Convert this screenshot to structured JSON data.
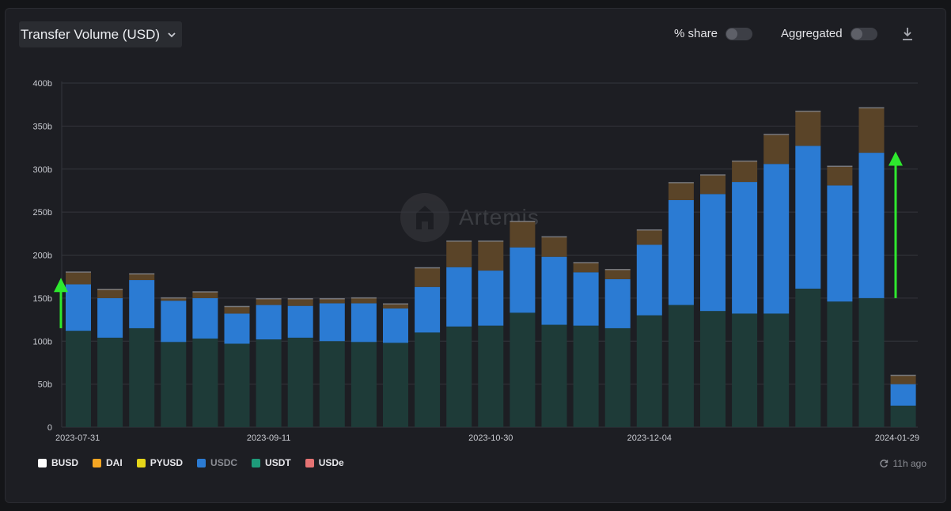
{
  "header": {
    "metric_label": "Transfer Volume (USD)",
    "share_label": "% share",
    "aggregated_label": "Aggregated",
    "share_on": false,
    "aggregated_on": false
  },
  "watermark": "Artemis",
  "updated": "11h ago",
  "colors": {
    "USDT": "#1e3b38",
    "USDC": "#2b7bd3",
    "other": "#5a4428",
    "arrow": "#2ee82e",
    "grid": "#34363c",
    "axis_text": "#c9cbd1"
  },
  "legend": [
    {
      "name": "BUSD",
      "color": "#ffffff",
      "dim": false
    },
    {
      "name": "DAI",
      "color": "#f5a623",
      "dim": false
    },
    {
      "name": "PYUSD",
      "color": "#e6d619",
      "dim": false
    },
    {
      "name": "USDC",
      "color": "#2b7bd3",
      "dim": true
    },
    {
      "name": "USDT",
      "color": "#1e9b7a",
      "dim": false
    },
    {
      "name": "USDe",
      "color": "#e57373",
      "dim": false
    }
  ],
  "chart_data": {
    "type": "bar",
    "stacked": true,
    "title": "Transfer Volume (USD)",
    "ylim": [
      0,
      400
    ],
    "y_unit": "b",
    "y_ticks": [
      "0",
      "50b",
      "100b",
      "150b",
      "200b",
      "250b",
      "300b",
      "350b",
      "400b"
    ],
    "x_tick_labels": [
      {
        "index": 0,
        "label": "2023-07-31"
      },
      {
        "index": 6,
        "label": "2023-09-11"
      },
      {
        "index": 13,
        "label": "2023-10-30"
      },
      {
        "index": 18,
        "label": "2023-12-04"
      },
      {
        "index": 26,
        "label": "2024-01-29"
      }
    ],
    "weeks": 27,
    "series": [
      {
        "name": "USDT",
        "values": [
          112,
          104,
          115,
          99,
          103,
          97,
          102,
          104,
          100,
          99,
          98,
          110,
          117,
          118,
          133,
          119,
          118,
          115,
          130,
          142,
          135,
          132,
          132,
          161,
          146,
          150,
          25
        ]
      },
      {
        "name": "USDC",
        "values": [
          54,
          46,
          56,
          48,
          47,
          35,
          40,
          37,
          44,
          45,
          40,
          53,
          69,
          64,
          76,
          79,
          62,
          57,
          82,
          122,
          136,
          153,
          174,
          166,
          135,
          169,
          25
        ]
      },
      {
        "name": "Other",
        "values": [
          14,
          10,
          7,
          3,
          7,
          8,
          7,
          8,
          5,
          6,
          5,
          22,
          30,
          34,
          30,
          23,
          11,
          11,
          17,
          20,
          22,
          24,
          34,
          40,
          22,
          52,
          10
        ]
      }
    ],
    "annotations": [
      {
        "type": "arrow",
        "x_index": 0,
        "y_from": 115,
        "y_to": 168
      },
      {
        "type": "arrow",
        "x_index": 26,
        "y_from": 150,
        "y_to": 315
      }
    ],
    "legend_position": "bottom-left",
    "grid": true
  }
}
